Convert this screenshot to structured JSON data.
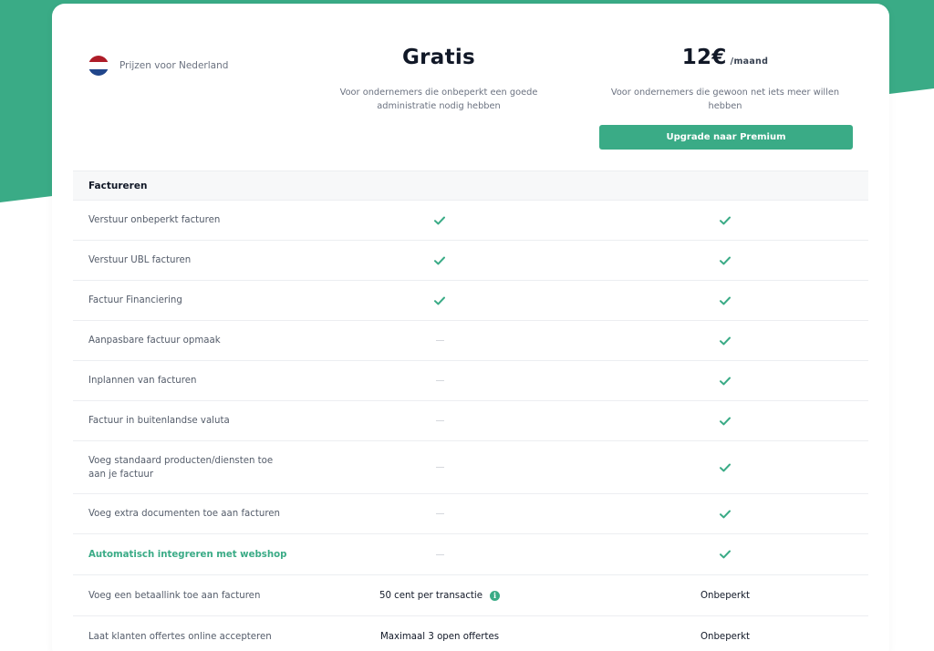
{
  "colors": {
    "accent": "#3aab86",
    "heading": "#111827",
    "muted": "#6b7280"
  },
  "country": {
    "label": "Prijzen voor Nederland",
    "flag_icon": "netherlands-flag-icon"
  },
  "plans": {
    "free": {
      "name": "Gratis",
      "description": "Voor ondernemers die onbeperkt een goede administratie nodig hebben"
    },
    "premium": {
      "price": "12€",
      "unit": "/maand",
      "description": "Voor ondernemers die gewoon net iets meer willen hebben",
      "button_label": "Upgrade naar Premium"
    }
  },
  "section": {
    "title": "Factureren"
  },
  "rows": [
    {
      "label": "Verstuur onbeperkt facturen",
      "free": "check",
      "premium": "check"
    },
    {
      "label": "Verstuur UBL facturen",
      "free": "check",
      "premium": "check"
    },
    {
      "label": "Factuur Financiering",
      "free": "check",
      "premium": "check"
    },
    {
      "label": "Aanpasbare factuur opmaak",
      "free": "dash",
      "premium": "check"
    },
    {
      "label": "Inplannen van facturen",
      "free": "dash",
      "premium": "check"
    },
    {
      "label": "Factuur in buitenlandse valuta",
      "free": "dash",
      "premium": "check"
    },
    {
      "label": "Voeg standaard producten/diensten toe aan je factuur",
      "free": "dash",
      "premium": "check"
    },
    {
      "label": "Voeg extra documenten toe aan facturen",
      "free": "dash",
      "premium": "check"
    },
    {
      "label": "Automatisch integreren met webshop",
      "free": "dash",
      "premium": "check",
      "highlight": true
    },
    {
      "label": "Voeg een betaallink toe aan facturen",
      "free_text": "50 cent per transactie",
      "free_info": true,
      "premium_text": "Onbeperkt"
    },
    {
      "label": "Laat klanten offertes online accepteren",
      "free_text": "Maximaal 3 open offertes",
      "premium_text": "Onbeperkt"
    }
  ]
}
